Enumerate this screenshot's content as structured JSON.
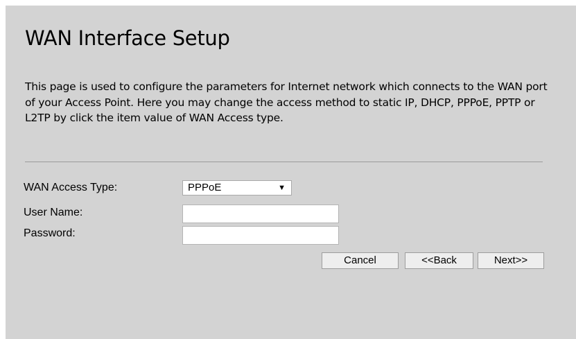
{
  "page": {
    "title": "WAN Interface Setup",
    "description": "This page is used to configure the parameters for Internet network which connects to the WAN port of your Access Point. Here you may change the access method to static IP, DHCP, PPPoE, PPTP or L2TP by click the item value of WAN Access type."
  },
  "form": {
    "wan_access_type_label": "WAN Access Type:",
    "wan_access_type_value": "PPPoE",
    "user_name_label": "User Name:",
    "user_name_value": "",
    "password_label": "Password:",
    "password_value": ""
  },
  "buttons": {
    "cancel": "Cancel",
    "back": "<<Back",
    "next": "Next>>"
  },
  "icons": {
    "dropdown": "chevron-down-icon"
  },
  "colors": {
    "background": "#d3d3d3"
  }
}
